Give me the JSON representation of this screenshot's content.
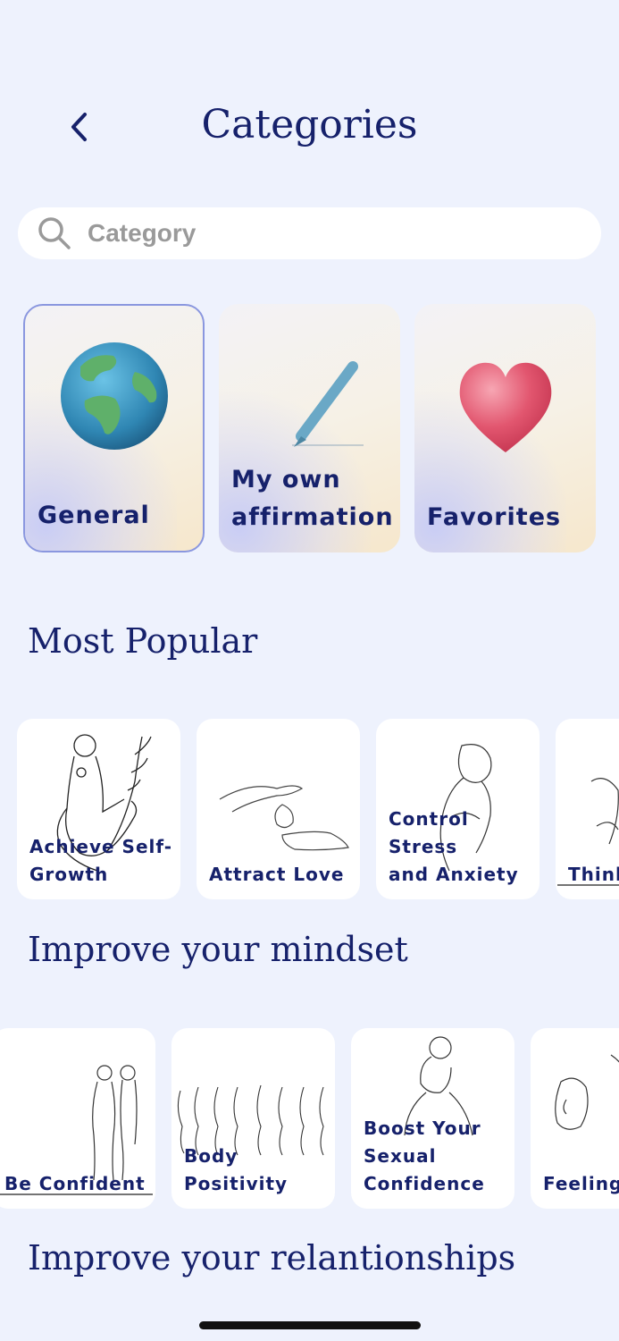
{
  "header": {
    "title": "Categories",
    "back_icon": "chevron-left-icon"
  },
  "search": {
    "placeholder": "Category",
    "icon": "search-icon"
  },
  "top_cards": [
    {
      "label": "General",
      "icon": "globe-icon",
      "selected": true
    },
    {
      "label": "My own\naffirmation",
      "icon": "pencil-icon",
      "selected": false
    },
    {
      "label": "Favorites",
      "icon": "heart-icon",
      "selected": false
    }
  ],
  "sections": [
    {
      "title": "Most Popular",
      "items": [
        {
          "label": "Achieve Self-\nGrowth"
        },
        {
          "label": "Attract Love"
        },
        {
          "label": "Control Stress\nand Anxiety"
        },
        {
          "label": "Think"
        }
      ]
    },
    {
      "title": "Improve your mindset",
      "items": [
        {
          "label": "Be Confident"
        },
        {
          "label": "Body\nPositivity"
        },
        {
          "label": "Boost Your\nSexual\nConfidence"
        },
        {
          "label": "Feeling"
        }
      ]
    },
    {
      "title": "Improve your relantionships",
      "items": []
    }
  ],
  "colors": {
    "background": "#eef2fd",
    "text": "#16216b",
    "accent_border": "#8a97df"
  }
}
